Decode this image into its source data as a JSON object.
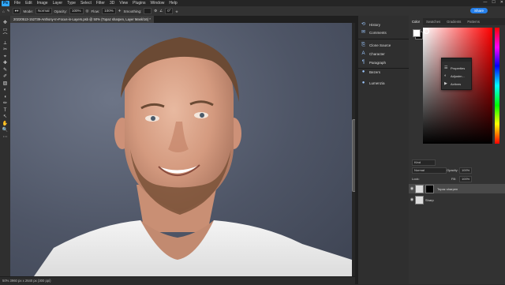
{
  "menu": {
    "logo": "Ps",
    "items": [
      "File",
      "Edit",
      "Image",
      "Layer",
      "Type",
      "Select",
      "Filter",
      "3D",
      "View",
      "Plugins",
      "Window",
      "Help"
    ],
    "window_controls": [
      "—",
      "☐",
      "✕"
    ]
  },
  "options": {
    "mode_label": "Mode:",
    "mode_value": "Normal",
    "opacity_label": "Opacity:",
    "opacity_value": "100%",
    "flow_label": "Flow:",
    "flow_value": "100%",
    "smoothing_label": "Smoothing:",
    "angle_value": "0°",
    "share_label": "Share"
  },
  "document": {
    "tab_title": "20220513-152739-Anthony-In-Focus-in-Layers.psb @ 50% (Topaz sharpen, Layer Mask/16) *",
    "zoom": "50%",
    "status": "50%    3960 px x 2640 px (300 ppi)"
  },
  "tools": [
    "✥",
    "▭",
    "⌒",
    "⟂",
    "✂",
    "⌖",
    "✚",
    "✎",
    "✐",
    "▨",
    "◐",
    "◖",
    "✏",
    "T",
    "↖",
    "✋",
    "🔍",
    "⋯"
  ],
  "collapsed_panels": {
    "group1": [
      {
        "label": "History",
        "icon": "history-icon"
      },
      {
        "label": "Comments",
        "icon": "comments-icon"
      }
    ],
    "group2": [
      {
        "label": "Clone Source",
        "icon": "clone-source-icon"
      },
      {
        "label": "Character",
        "icon": "character-icon"
      },
      {
        "label": "Paragraph",
        "icon": "paragraph-icon"
      }
    ],
    "group3": [
      {
        "label": "Bezers",
        "icon": "bezers-icon"
      },
      {
        "label": "Lumenzia",
        "icon": "lumenzia-icon"
      }
    ]
  },
  "color_panel": {
    "tabs": [
      "Color",
      "Swatches",
      "Gradients",
      "Patterns"
    ],
    "foreground": "#ffffff",
    "background": "#000000"
  },
  "floating_panel": {
    "items": [
      {
        "label": "Properties",
        "icon": "properties-icon"
      },
      {
        "label": "Adjustm...",
        "icon": "adjustments-icon"
      },
      {
        "label": "Actions",
        "icon": "actions-icon"
      }
    ]
  },
  "layers_panel": {
    "tabs": [
      "Layers",
      "Channels",
      "Paths",
      "Brush Settings",
      "Brushes"
    ],
    "filter_label": "Kind",
    "blend_mode": "Normal",
    "opacity_label": "Opacity:",
    "opacity_value": "100%",
    "lock_label": "Lock:",
    "fill_label": "Fill:",
    "fill_value": "100%",
    "layers": [
      {
        "name": "Topaz sharpen",
        "selected": true,
        "has_mask": true
      },
      {
        "name": "Sharp",
        "selected": false,
        "has_mask": false
      }
    ]
  }
}
